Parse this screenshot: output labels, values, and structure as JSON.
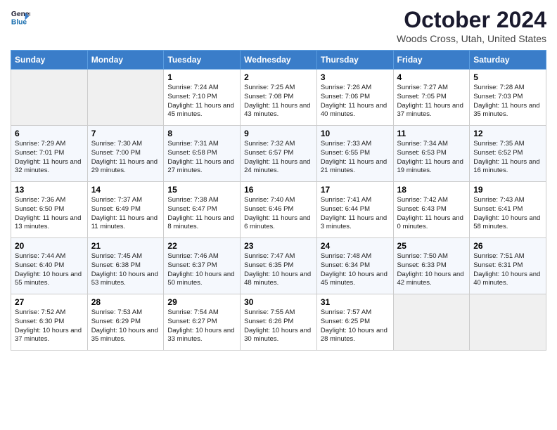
{
  "header": {
    "logo_line1": "General",
    "logo_line2": "Blue",
    "month": "October 2024",
    "location": "Woods Cross, Utah, United States"
  },
  "weekdays": [
    "Sunday",
    "Monday",
    "Tuesday",
    "Wednesday",
    "Thursday",
    "Friday",
    "Saturday"
  ],
  "weeks": [
    [
      {
        "day": "",
        "sunrise": "",
        "sunset": "",
        "daylight": "",
        "empty": true
      },
      {
        "day": "",
        "sunrise": "",
        "sunset": "",
        "daylight": "",
        "empty": true
      },
      {
        "day": "1",
        "sunrise": "Sunrise: 7:24 AM",
        "sunset": "Sunset: 7:10 PM",
        "daylight": "Daylight: 11 hours and 45 minutes."
      },
      {
        "day": "2",
        "sunrise": "Sunrise: 7:25 AM",
        "sunset": "Sunset: 7:08 PM",
        "daylight": "Daylight: 11 hours and 43 minutes."
      },
      {
        "day": "3",
        "sunrise": "Sunrise: 7:26 AM",
        "sunset": "Sunset: 7:06 PM",
        "daylight": "Daylight: 11 hours and 40 minutes."
      },
      {
        "day": "4",
        "sunrise": "Sunrise: 7:27 AM",
        "sunset": "Sunset: 7:05 PM",
        "daylight": "Daylight: 11 hours and 37 minutes."
      },
      {
        "day": "5",
        "sunrise": "Sunrise: 7:28 AM",
        "sunset": "Sunset: 7:03 PM",
        "daylight": "Daylight: 11 hours and 35 minutes."
      }
    ],
    [
      {
        "day": "6",
        "sunrise": "Sunrise: 7:29 AM",
        "sunset": "Sunset: 7:01 PM",
        "daylight": "Daylight: 11 hours and 32 minutes."
      },
      {
        "day": "7",
        "sunrise": "Sunrise: 7:30 AM",
        "sunset": "Sunset: 7:00 PM",
        "daylight": "Daylight: 11 hours and 29 minutes."
      },
      {
        "day": "8",
        "sunrise": "Sunrise: 7:31 AM",
        "sunset": "Sunset: 6:58 PM",
        "daylight": "Daylight: 11 hours and 27 minutes."
      },
      {
        "day": "9",
        "sunrise": "Sunrise: 7:32 AM",
        "sunset": "Sunset: 6:57 PM",
        "daylight": "Daylight: 11 hours and 24 minutes."
      },
      {
        "day": "10",
        "sunrise": "Sunrise: 7:33 AM",
        "sunset": "Sunset: 6:55 PM",
        "daylight": "Daylight: 11 hours and 21 minutes."
      },
      {
        "day": "11",
        "sunrise": "Sunrise: 7:34 AM",
        "sunset": "Sunset: 6:53 PM",
        "daylight": "Daylight: 11 hours and 19 minutes."
      },
      {
        "day": "12",
        "sunrise": "Sunrise: 7:35 AM",
        "sunset": "Sunset: 6:52 PM",
        "daylight": "Daylight: 11 hours and 16 minutes."
      }
    ],
    [
      {
        "day": "13",
        "sunrise": "Sunrise: 7:36 AM",
        "sunset": "Sunset: 6:50 PM",
        "daylight": "Daylight: 11 hours and 13 minutes."
      },
      {
        "day": "14",
        "sunrise": "Sunrise: 7:37 AM",
        "sunset": "Sunset: 6:49 PM",
        "daylight": "Daylight: 11 hours and 11 minutes."
      },
      {
        "day": "15",
        "sunrise": "Sunrise: 7:38 AM",
        "sunset": "Sunset: 6:47 PM",
        "daylight": "Daylight: 11 hours and 8 minutes."
      },
      {
        "day": "16",
        "sunrise": "Sunrise: 7:40 AM",
        "sunset": "Sunset: 6:46 PM",
        "daylight": "Daylight: 11 hours and 6 minutes."
      },
      {
        "day": "17",
        "sunrise": "Sunrise: 7:41 AM",
        "sunset": "Sunset: 6:44 PM",
        "daylight": "Daylight: 11 hours and 3 minutes."
      },
      {
        "day": "18",
        "sunrise": "Sunrise: 7:42 AM",
        "sunset": "Sunset: 6:43 PM",
        "daylight": "Daylight: 11 hours and 0 minutes."
      },
      {
        "day": "19",
        "sunrise": "Sunrise: 7:43 AM",
        "sunset": "Sunset: 6:41 PM",
        "daylight": "Daylight: 10 hours and 58 minutes."
      }
    ],
    [
      {
        "day": "20",
        "sunrise": "Sunrise: 7:44 AM",
        "sunset": "Sunset: 6:40 PM",
        "daylight": "Daylight: 10 hours and 55 minutes."
      },
      {
        "day": "21",
        "sunrise": "Sunrise: 7:45 AM",
        "sunset": "Sunset: 6:38 PM",
        "daylight": "Daylight: 10 hours and 53 minutes."
      },
      {
        "day": "22",
        "sunrise": "Sunrise: 7:46 AM",
        "sunset": "Sunset: 6:37 PM",
        "daylight": "Daylight: 10 hours and 50 minutes."
      },
      {
        "day": "23",
        "sunrise": "Sunrise: 7:47 AM",
        "sunset": "Sunset: 6:35 PM",
        "daylight": "Daylight: 10 hours and 48 minutes."
      },
      {
        "day": "24",
        "sunrise": "Sunrise: 7:48 AM",
        "sunset": "Sunset: 6:34 PM",
        "daylight": "Daylight: 10 hours and 45 minutes."
      },
      {
        "day": "25",
        "sunrise": "Sunrise: 7:50 AM",
        "sunset": "Sunset: 6:33 PM",
        "daylight": "Daylight: 10 hours and 42 minutes."
      },
      {
        "day": "26",
        "sunrise": "Sunrise: 7:51 AM",
        "sunset": "Sunset: 6:31 PM",
        "daylight": "Daylight: 10 hours and 40 minutes."
      }
    ],
    [
      {
        "day": "27",
        "sunrise": "Sunrise: 7:52 AM",
        "sunset": "Sunset: 6:30 PM",
        "daylight": "Daylight: 10 hours and 37 minutes."
      },
      {
        "day": "28",
        "sunrise": "Sunrise: 7:53 AM",
        "sunset": "Sunset: 6:29 PM",
        "daylight": "Daylight: 10 hours and 35 minutes."
      },
      {
        "day": "29",
        "sunrise": "Sunrise: 7:54 AM",
        "sunset": "Sunset: 6:27 PM",
        "daylight": "Daylight: 10 hours and 33 minutes."
      },
      {
        "day": "30",
        "sunrise": "Sunrise: 7:55 AM",
        "sunset": "Sunset: 6:26 PM",
        "daylight": "Daylight: 10 hours and 30 minutes."
      },
      {
        "day": "31",
        "sunrise": "Sunrise: 7:57 AM",
        "sunset": "Sunset: 6:25 PM",
        "daylight": "Daylight: 10 hours and 28 minutes."
      },
      {
        "day": "",
        "sunrise": "",
        "sunset": "",
        "daylight": "",
        "empty": true
      },
      {
        "day": "",
        "sunrise": "",
        "sunset": "",
        "daylight": "",
        "empty": true
      }
    ]
  ]
}
